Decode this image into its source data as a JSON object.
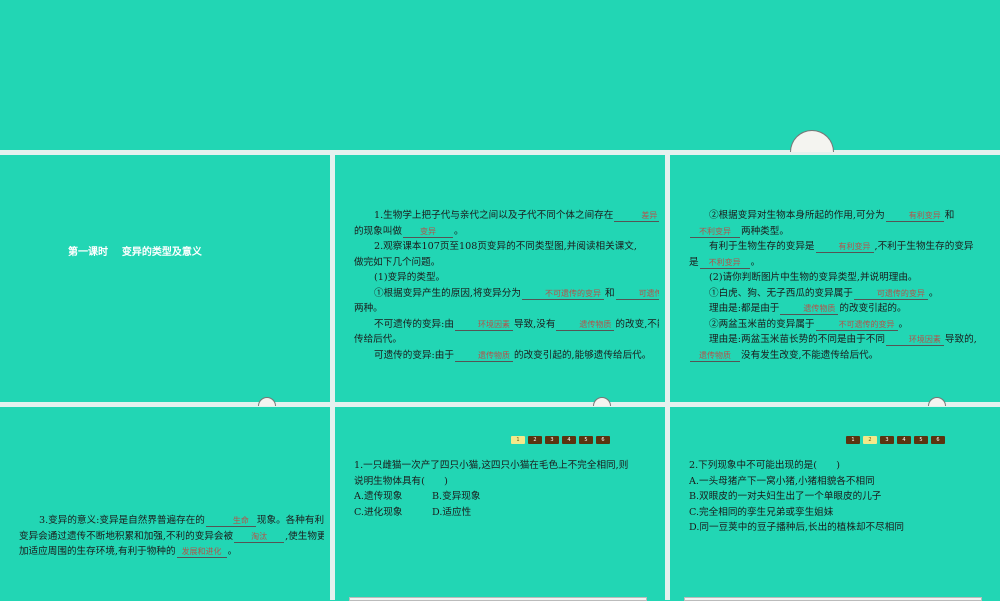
{
  "title_panel": {
    "title": "第一课时    变异的类型及意义"
  },
  "panel2": [
    [
      {
        "t": "1.生物学上把子代与亲代之间以及子代不同个体之间存在"
      },
      {
        "b": "差异"
      }
    ],
    [
      {
        "t": "的现象叫做"
      },
      {
        "b": "变异"
      },
      {
        "t": "。"
      }
    ],
    [
      {
        "t": "2.观察课本107页至108页变异的不同类型图,并阅读相关课文,"
      }
    ],
    [
      {
        "t": "做完如下几个问题。"
      }
    ],
    [
      {
        "t": "(1)变异的类型。"
      }
    ],
    [
      {
        "t": "①根据变异产生的原因,将变异分为"
      },
      {
        "b": "不可遗传的变异"
      },
      {
        "t": "和"
      },
      {
        "b": "可遗传的变异"
      }
    ],
    [
      {
        "t": "两种。"
      }
    ],
    [
      {
        "t": "不可遗传的变异:由"
      },
      {
        "b": "环境因素"
      },
      {
        "t": "导致,没有"
      },
      {
        "b": "遗传物质"
      },
      {
        "t": "的改变,不能遗"
      }
    ],
    [
      {
        "t": "传给后代。"
      }
    ],
    [
      {
        "t": "可遗传的变异:由于"
      },
      {
        "b": "遗传物质"
      },
      {
        "t": "的改变引起的,能够遗传给后代。"
      }
    ]
  ],
  "panel3": [
    [
      {
        "t": "②根据变异对生物本身所起的作用,可分为"
      },
      {
        "b": "有利变异"
      },
      {
        "t": "和"
      }
    ],
    [
      {
        "b": "不利变异"
      },
      {
        "t": "两种类型。"
      }
    ],
    [
      {
        "t": "有利于生物生存的变异是"
      },
      {
        "b": "有利变异"
      },
      {
        "t": ",不利于生物生存的变异"
      }
    ],
    [
      {
        "t": "是"
      },
      {
        "b": "不利变异"
      },
      {
        "t": "。"
      }
    ],
    [
      {
        "t": "(2)请你判断图片中生物的变异类型,并说明理由。"
      }
    ],
    [
      {
        "t": "①白虎、狗、无子西瓜的变异属于"
      },
      {
        "b": "可遗传的变异"
      },
      {
        "t": "。"
      }
    ],
    [
      {
        "t": "理由是:都是由于"
      },
      {
        "b": "遗传物质"
      },
      {
        "t": "的改变引起的。"
      }
    ],
    [
      {
        "t": "②两盆玉米苗的变异属于"
      },
      {
        "b": "不可遗传的变异"
      },
      {
        "t": "。"
      }
    ],
    [
      {
        "t": "理由是:两盆玉米苗长势的不同是由于不同"
      },
      {
        "b": "环境因素"
      },
      {
        "t": "导致的,"
      }
    ],
    [
      {
        "b": "遗传物质"
      },
      {
        "t": "没有发生改变,不能遗传给后代。"
      }
    ]
  ],
  "panel4": [
    [
      {
        "t": "3.变异的意义:变异是自然界普遍存在的"
      },
      {
        "b": "生命"
      },
      {
        "t": "现象。各种有利的"
      }
    ],
    [
      {
        "t": "变异会通过遗传不断地积累和加强,不利的变异会被"
      },
      {
        "b": "淘汰"
      },
      {
        "t": ",使生物更"
      }
    ],
    [
      {
        "t": "加适应周围的生存环境,有利于物种的"
      },
      {
        "b": "发展和进化"
      },
      {
        "t": "。"
      }
    ]
  ],
  "pager": [
    "1",
    "2",
    "3",
    "4",
    "5",
    "6"
  ],
  "q1": {
    "stem": [
      "1.一只雌猫一次产了四只小猫,这四只小猫在毛色上不完全相同,则",
      "说明生物体具有(　　)"
    ],
    "options": [
      [
        "A.遗传现象",
        "B.变异现象"
      ],
      [
        "C.进化现象",
        "D.适应性"
      ]
    ]
  },
  "q2": {
    "stem": "2.下列现象中不可能出现的是(　　)",
    "options": [
      "A.一头母猪产下一窝小猪,小猪相貌各不相同",
      "B.双眼皮的一对夫妇生出了一个单眼皮的儿子",
      "C.完全相同的孪生兄弟或孪生姐妹",
      "D.同一豆荚中的豆子播种后,长出的植株却不尽相同"
    ]
  },
  "colors": {
    "background": "#22d6b4",
    "answer": "#b5524a",
    "pager_active": "#f3e98a",
    "pager": "#5a3410"
  }
}
